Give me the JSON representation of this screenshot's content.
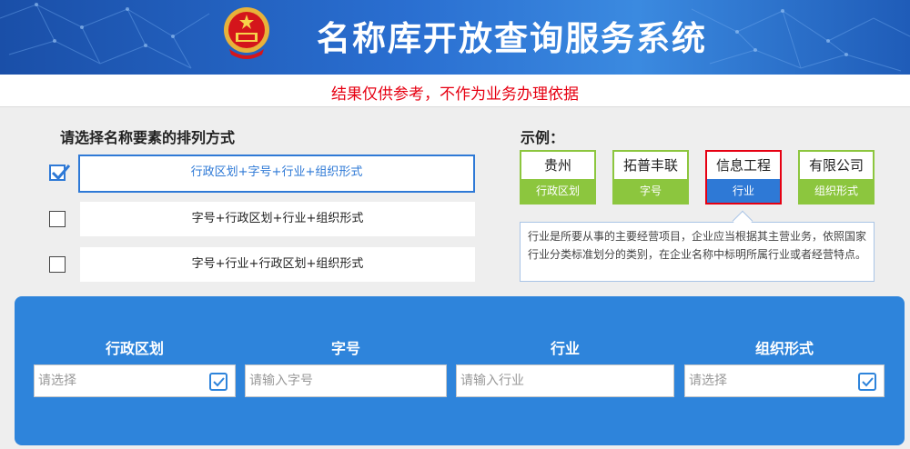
{
  "header": {
    "title": "名称库开放查询服务系统",
    "emblem_icon": "national-emblem-icon",
    "notice": "结果仅供参考，不作为业务办理依据"
  },
  "order_section": {
    "title": "请选择名称要素的排列方式",
    "options": [
      {
        "label": "行政区划+字号+行业+组织形式",
        "checked": true
      },
      {
        "label": "字号+行政区划+行业+组织形式",
        "checked": false
      },
      {
        "label": "字号+行业+行政区划+组织形式",
        "checked": false
      }
    ]
  },
  "example_section": {
    "title": "示例：",
    "items": [
      {
        "value": "贵州",
        "type": "行政区划",
        "active": false
      },
      {
        "value": "拓普丰联",
        "type": "字号",
        "active": false
      },
      {
        "value": "信息工程",
        "type": "行业",
        "active": true
      },
      {
        "value": "有限公司",
        "type": "组织形式",
        "active": false
      }
    ],
    "description": "行业是所要从事的主要经营项目，企业应当根据其主营业务，依照国家行业分类标准划分的类别，在企业名称中标明所属行业或者经营特点。"
  },
  "search_panel": {
    "fields": [
      {
        "label": "行政区划",
        "placeholder": "请选择",
        "value": "",
        "has_icon": true
      },
      {
        "label": "字号",
        "placeholder": "请输入字号",
        "value": "",
        "has_icon": false
      },
      {
        "label": "行业",
        "placeholder": "请输入行业",
        "value": "",
        "has_icon": false
      },
      {
        "label": "组织形式",
        "placeholder": "请选择",
        "value": "",
        "has_icon": true
      }
    ],
    "select_icon": "select-list-icon"
  },
  "colors": {
    "brand_blue": "#2e84db",
    "accent_blue": "#2e79d6",
    "example_green": "#8cc63e",
    "notice_red": "#e60012"
  }
}
